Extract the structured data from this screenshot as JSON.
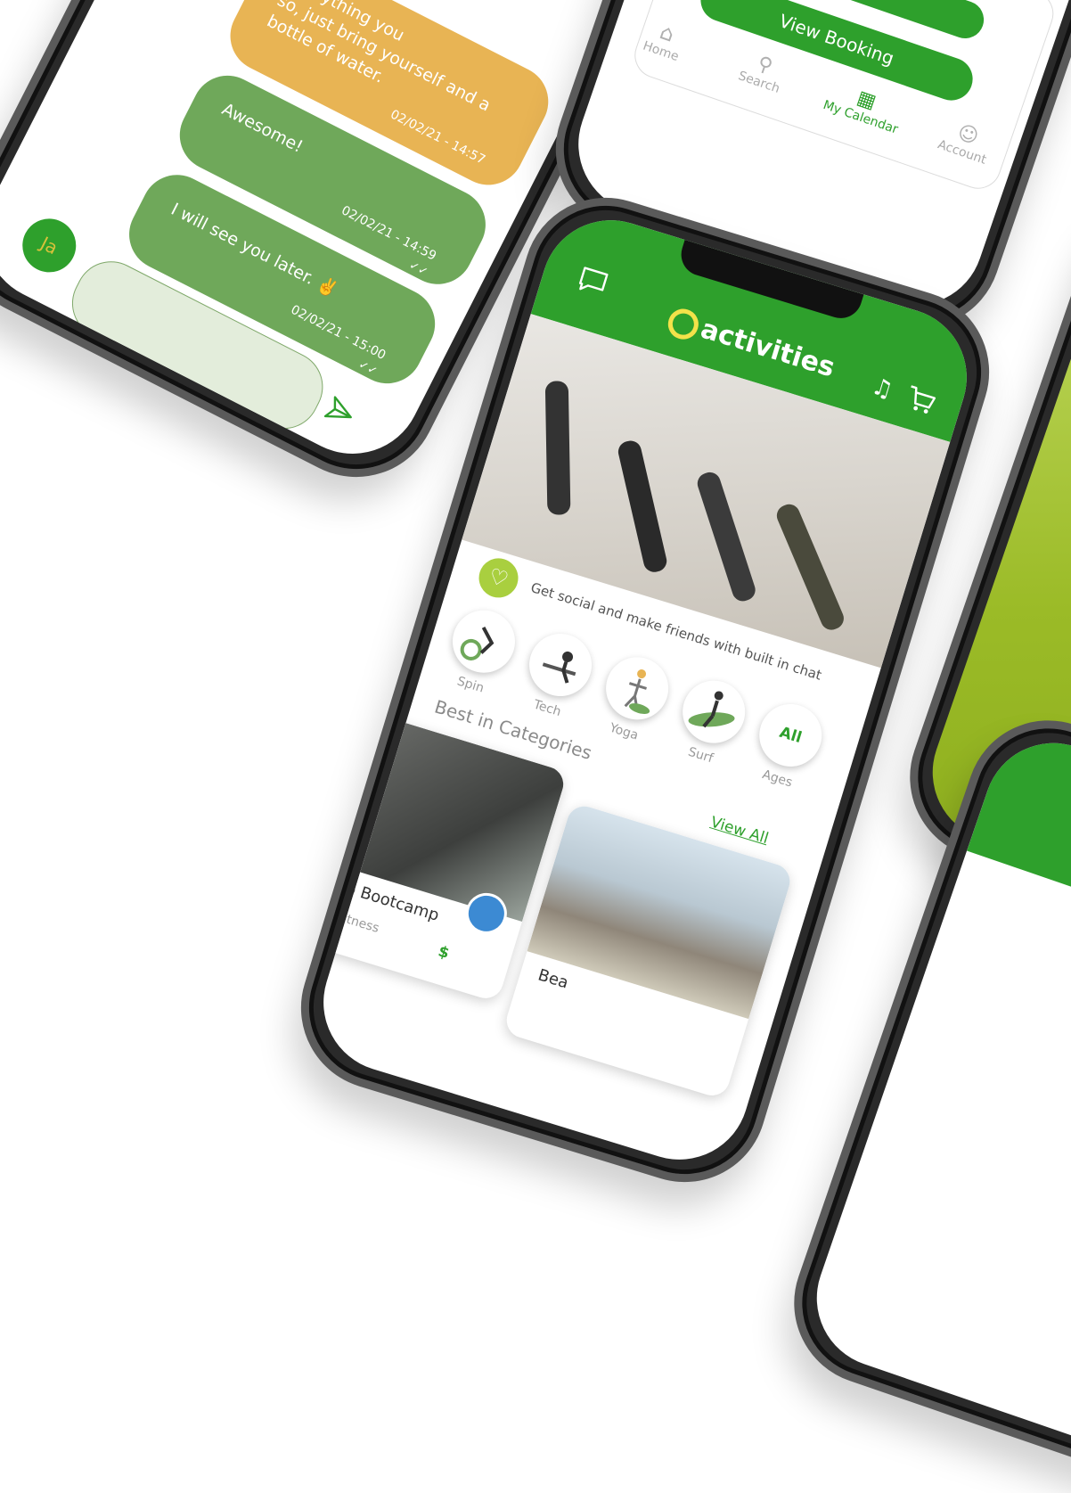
{
  "chat": {
    "messages": [
      {
        "text_lines": [
          "everything you",
          "so, just bring yourself and a",
          "bottle of water."
        ],
        "time": "02/02/21 - 14:57",
        "color": "#e8b454"
      },
      {
        "text": "Awesome!",
        "time": "02/02/21 - 14:59",
        "check": "✓✓",
        "color": "#6fa85a"
      },
      {
        "text": "I will see you later. ✌️",
        "time": "02/02/21 - 15:00",
        "check": "✓✓",
        "color": "#6fa85a"
      }
    ],
    "avatar_initials": "Ja",
    "input_placeholder": "",
    "send_icon": "send-icon"
  },
  "booking": {
    "view_booking_label": "View Booking",
    "nav": [
      {
        "label": "Home",
        "icon": "home-icon"
      },
      {
        "label": "Search",
        "icon": "search-icon"
      },
      {
        "label": "My Calendar",
        "icon": "calendar-icon",
        "active": true
      },
      {
        "label": "Account",
        "icon": "account-icon"
      }
    ]
  },
  "main": {
    "brand_name": "activities",
    "promo_text": "Get social and make friends with built in chat",
    "categories": [
      {
        "label": "Spin"
      },
      {
        "label": "Tech"
      },
      {
        "label": "Yoga"
      },
      {
        "label": "Surf"
      },
      {
        "label": "Ages",
        "circle_text": "All"
      }
    ],
    "section_title": "Best in Categories",
    "view_all_label": "View All",
    "cards": [
      {
        "title": "p Bootcamp",
        "subtitle": "Fitness",
        "price": "$"
      },
      {
        "title": "Bea"
      }
    ]
  },
  "colors": {
    "brand_green": "#2ea02c",
    "bubble_green": "#6fa85a",
    "bubble_orange": "#e8b454",
    "lime": "#a9cf3f"
  }
}
